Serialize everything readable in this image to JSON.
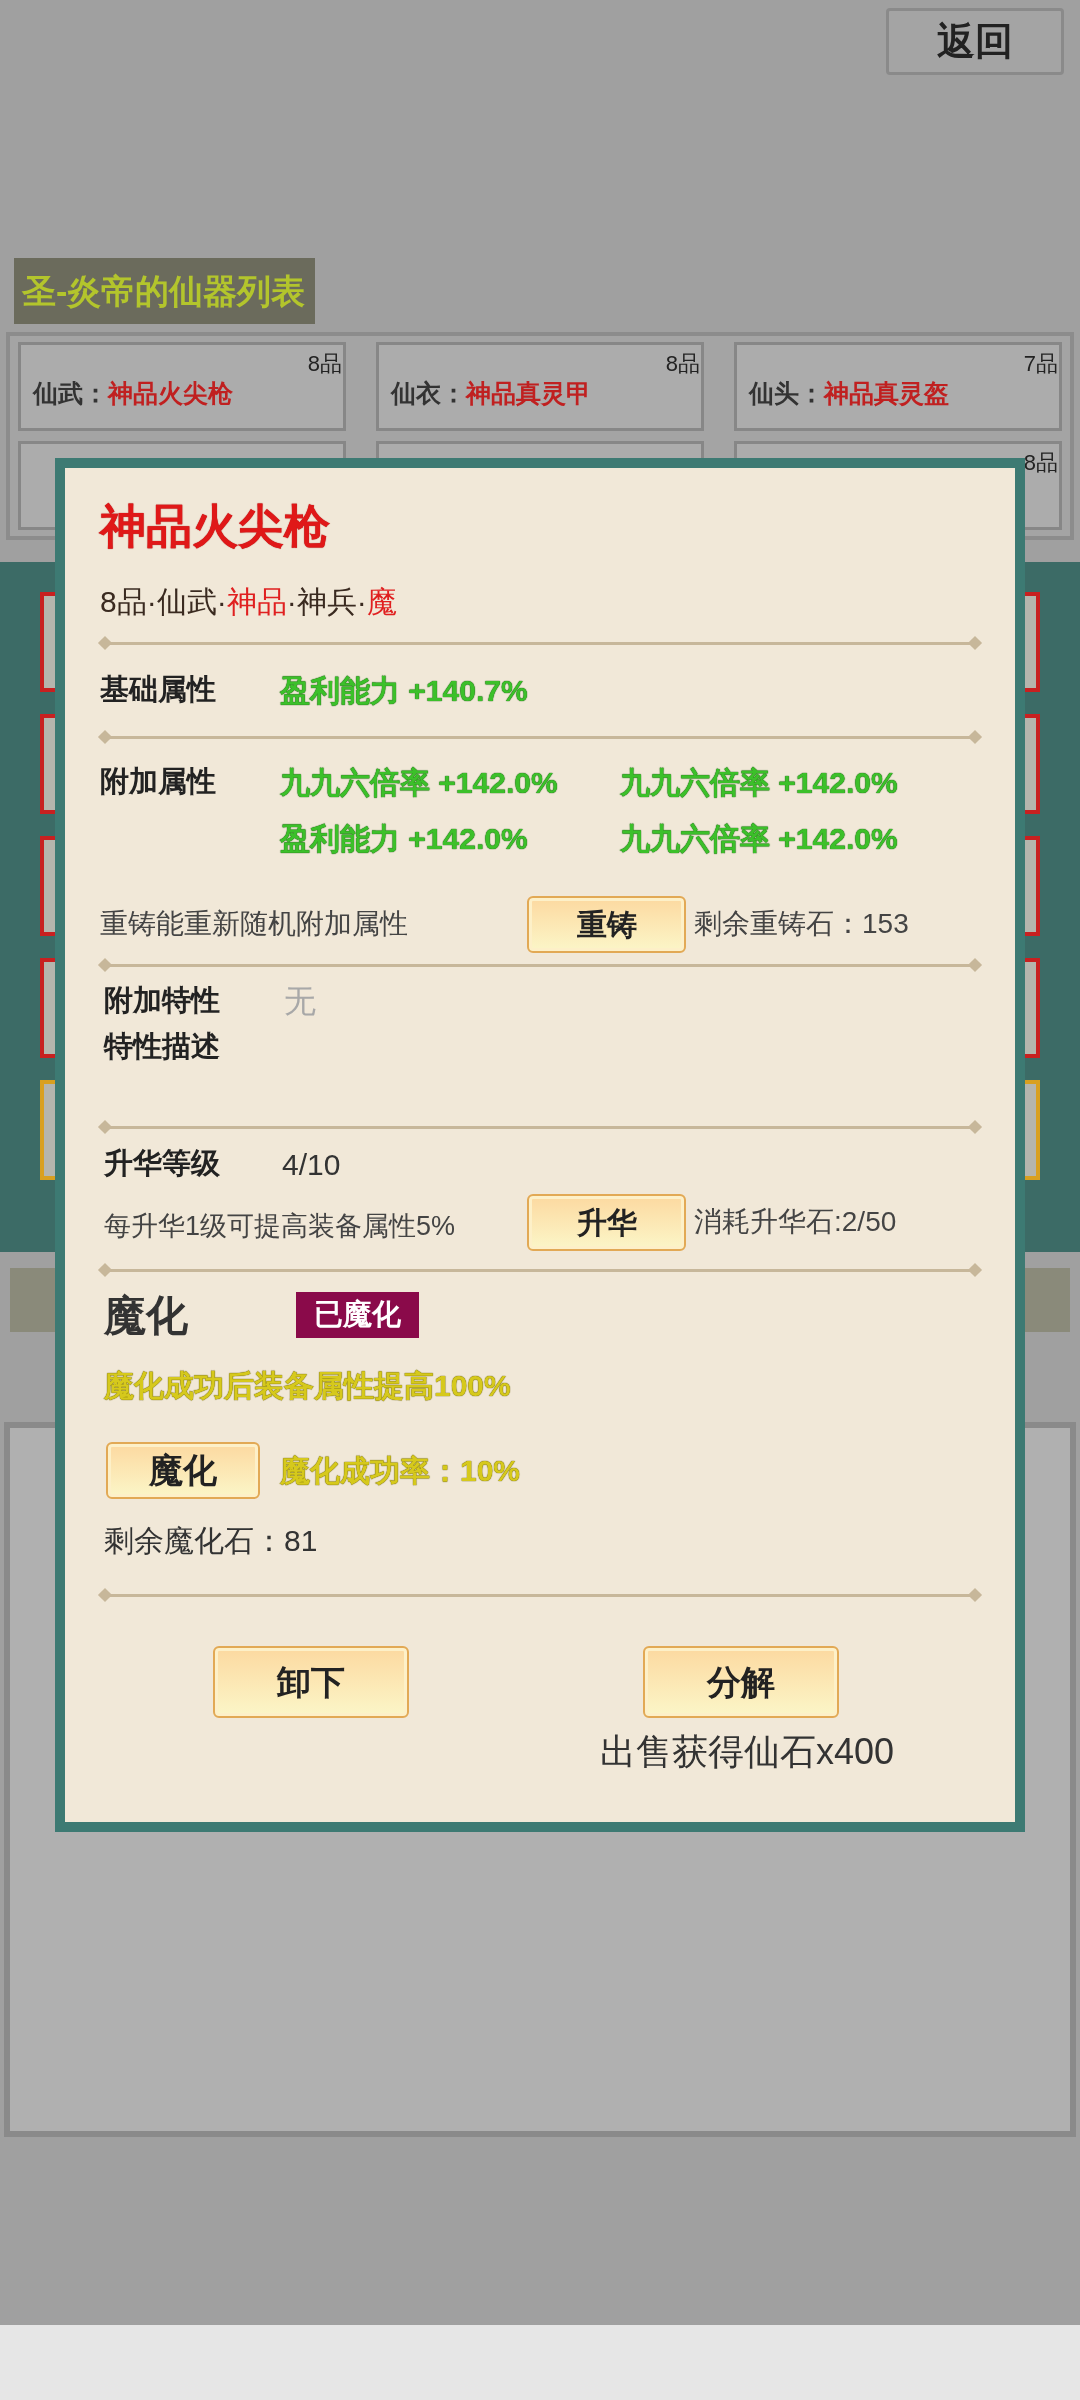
{
  "back_button": "返回",
  "list_title": "圣-炎帝的仙器列表",
  "equipment_cards": [
    {
      "slot": "仙武：",
      "name": "神品火尖枪",
      "grade": "8品"
    },
    {
      "slot": "仙衣：",
      "name": "神品真灵甲",
      "grade": "8品"
    },
    {
      "slot": "仙头：",
      "name": "神品真灵盔",
      "grade": "7品"
    },
    {
      "grade": "8品"
    }
  ],
  "dialog": {
    "title": "神品火尖枪",
    "subtitle": [
      {
        "text": "8品·仙武·",
        "highlight": false
      },
      {
        "text": "神品",
        "highlight": true
      },
      {
        "text": "·神兵·",
        "highlight": false
      },
      {
        "text": "魔",
        "highlight": true
      }
    ],
    "base_attr": {
      "label": "基础属性",
      "values": [
        "盈利能力 +140.7%"
      ]
    },
    "extra_attr": {
      "label": "附加属性",
      "values": [
        "九九六倍率 +142.0%",
        "九九六倍率 +142.0%",
        "盈利能力 +142.0%",
        "九九六倍率 +142.0%"
      ]
    },
    "reforge": {
      "description": "重铸能重新随机附加属性",
      "button": "重铸",
      "remaining": "剩余重铸石：153"
    },
    "traits": {
      "label": "附加特性",
      "value": "无",
      "desc_label": "特性描述"
    },
    "ascend": {
      "label": "升华等级",
      "value": "4/10",
      "description": "每升华1级可提高装备属性5%",
      "button": "升华",
      "cost": "消耗升华石:2/50"
    },
    "demonize": {
      "label": "魔化",
      "status": "已魔化",
      "demonized": true,
      "effect": "魔化成功后装备属性提高100%",
      "button": "魔化",
      "rate": "魔化成功率：10%",
      "remaining": "剩余魔化石：81"
    },
    "actions": {
      "unequip": "卸下",
      "decompose": "分解",
      "sell_note": "出售获得仙石x400"
    }
  }
}
